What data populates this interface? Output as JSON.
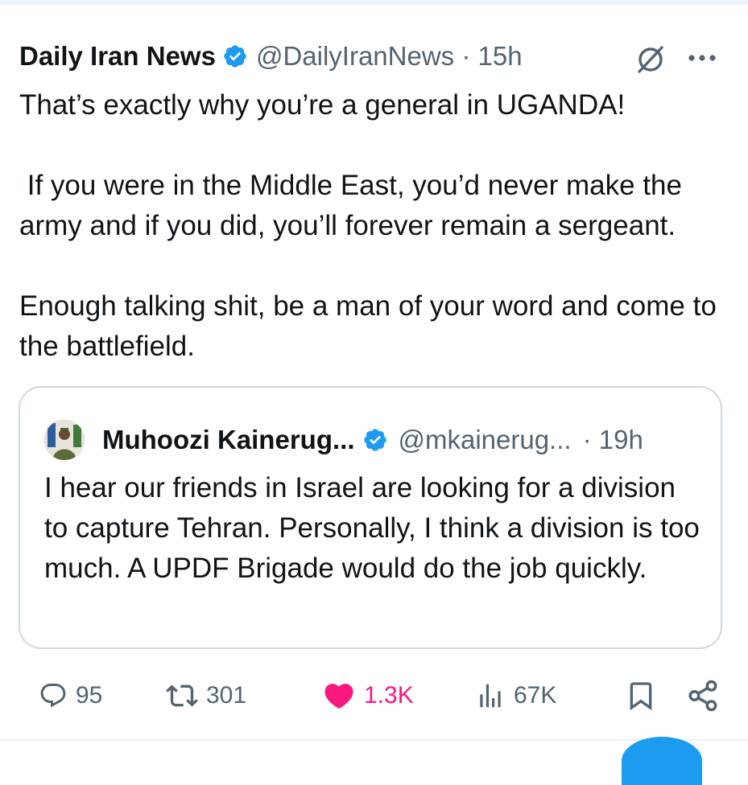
{
  "tweet": {
    "display_name": "Daily Iran News",
    "handle_time": "@DailyIranNews · 15h",
    "body": "That’s exactly why you’re a general in UGANDA!\n\n If you were in the Middle East, you’d never make the army and if you did, you’ll forever remain a sergeant.\n\nEnough talking shit, be a man of your word and come to the battlefield."
  },
  "quote": {
    "display_name": "Muhoozi Kainerug...",
    "handle": "@mkainerug...",
    "time": "· 19h",
    "body": "I hear our friends in Israel are looking for a division to capture Tehran. Personally, I think a division is too much. A UPDF Brigade would do the job quickly."
  },
  "actions": {
    "replies": "95",
    "reposts": "301",
    "likes": "1.3K",
    "views": "67K"
  },
  "icons": {
    "verified": "verified-badge-icon",
    "grok": "grok-icon",
    "more": "more-icon",
    "reply": "reply-icon",
    "repost": "repost-icon",
    "like": "heart-icon",
    "views": "views-icon",
    "bookmark": "bookmark-icon",
    "share": "share-icon"
  },
  "colors": {
    "verified_blue": "#1d9bf0",
    "like_pink": "#f91880",
    "secondary_text": "#536471"
  }
}
